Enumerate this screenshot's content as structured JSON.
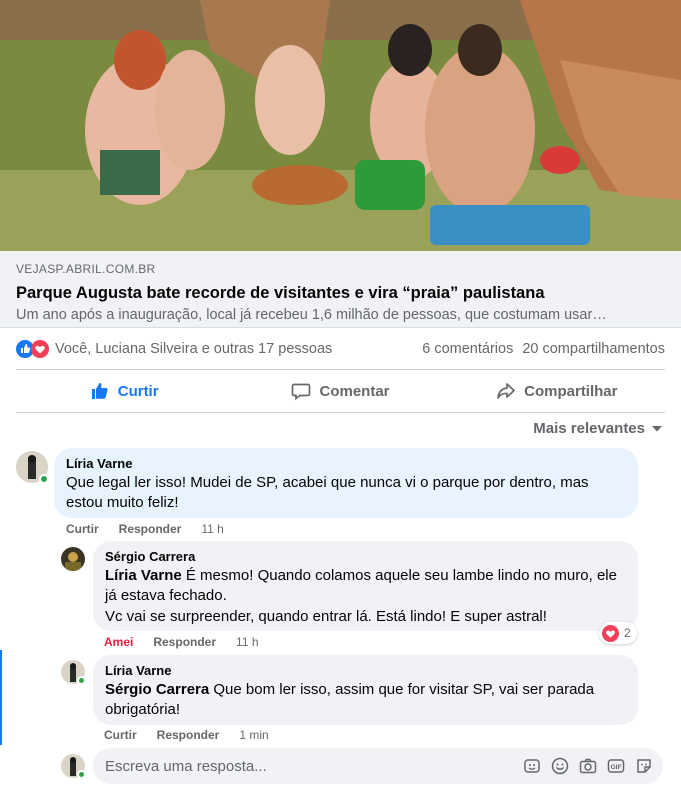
{
  "post": {
    "image": {
      "alt_subject": "people-sitting-on-grass-park"
    },
    "link": {
      "domain": "VEJASP.ABRIL.COM.BR",
      "title": "Parque Augusta bate recorde de visitantes e vira “praia” paulistana",
      "description": "Um ano após a inauguração, local já recebeu 1,6 milhão de pessoas, que costumam usar…"
    },
    "reactions": {
      "icons": [
        "like-icon",
        "heart-icon"
      ],
      "reactors_text": "Você, Luciana Silveira e outras 17 pessoas",
      "comments_count": "6 comentários",
      "shares_count": "20 compartilhamentos"
    },
    "actions": {
      "like": "Curtir",
      "comment": "Comentar",
      "share": "Compartilhar"
    },
    "sort_label": "Mais relevantes"
  },
  "comments": [
    {
      "author": "Líria Varne",
      "text": "Que legal ler isso! Mudei de SP, acabei que nunca vi o parque por dentro, mas estou muito feliz!",
      "like_label": "Curtir",
      "reply_label": "Responder",
      "time": "11 h"
    },
    {
      "author": "Sérgio Carrera",
      "mention": "Líria Varne",
      "text_line1": " É mesmo! Quando colamos aquele seu lambe lindo no muro, ele já estava fechado.",
      "text_line2": "Vc vai se surpreender, quando entrar lá. Está lindo! E super astral!",
      "like_label": "Amei",
      "reply_label": "Responder",
      "time": "11 h",
      "reaction_count": "2"
    },
    {
      "author": "Líria Varne",
      "mention": "Sérgio Carrera",
      "text": " Que bom ler isso, assim que for visitar SP, vai ser parada obrigatória!",
      "like_label": "Curtir",
      "reply_label": "Responder",
      "time": "1 min"
    }
  ],
  "reply_box": {
    "placeholder": "Escreva uma resposta..."
  },
  "colors": {
    "brand_blue": "#1877f2",
    "love_red": "#e41e3f",
    "online_green": "#31a24c",
    "bubble_blue": "#e7f3ff",
    "bubble_gray": "#f0f2f5"
  }
}
